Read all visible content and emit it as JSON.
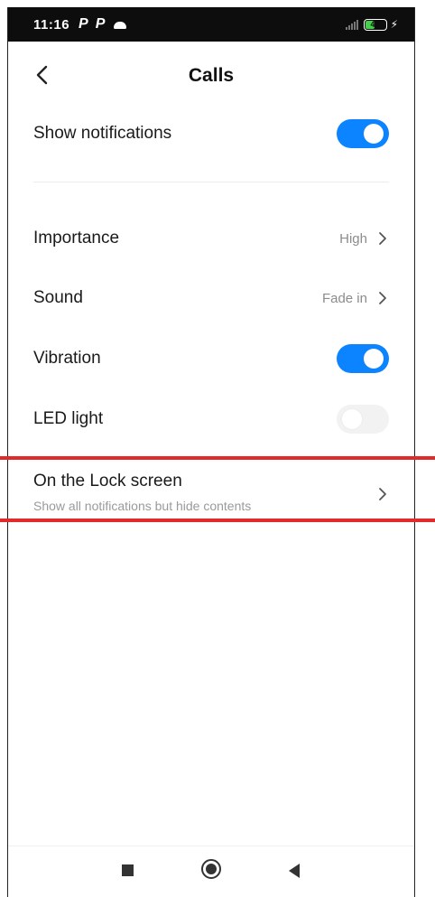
{
  "status_bar": {
    "time": "11:16",
    "notification_icons": [
      "P",
      "P"
    ],
    "battery_level": "45"
  },
  "header": {
    "title": "Calls"
  },
  "settings": {
    "show_notifications": {
      "label": "Show notifications",
      "enabled": true
    },
    "importance": {
      "label": "Importance",
      "value": "High"
    },
    "sound": {
      "label": "Sound",
      "value": "Fade in"
    },
    "vibration": {
      "label": "Vibration",
      "enabled": true
    },
    "led_light": {
      "label": "LED light",
      "enabled": false
    },
    "lock_screen": {
      "label": "On the Lock screen",
      "subtitle": "Show all notifications but hide contents"
    }
  },
  "colors": {
    "accent": "#0d84ff",
    "highlight": "#e12a2a"
  }
}
